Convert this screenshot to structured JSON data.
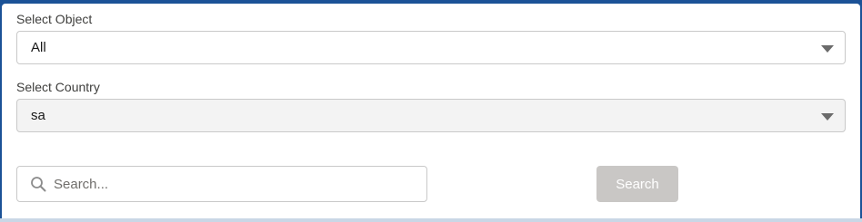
{
  "form": {
    "object_label": "Select Object",
    "object_value": "All",
    "country_label": "Select Country",
    "country_value": "sa",
    "search_placeholder": "Search...",
    "search_button_label": "Search"
  },
  "colors": {
    "header_background": "#1b5297",
    "disabled_button": "#c9c7c5",
    "disabled_field": "#f3f3f3"
  },
  "icons": {
    "search": "search-icon",
    "dropdown": "chevron-down-icon"
  }
}
